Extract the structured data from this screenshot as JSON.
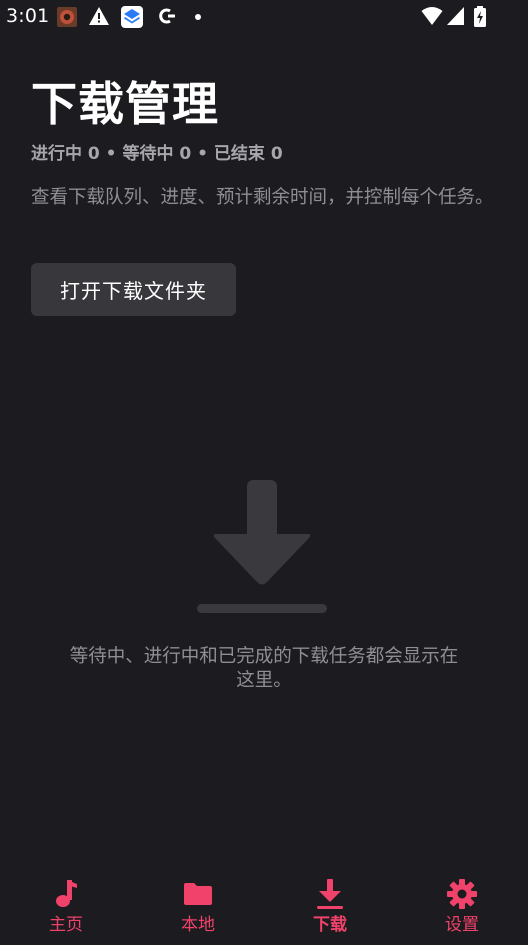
{
  "status_bar": {
    "time": "3:01",
    "left_icons": [
      "app-notification-icon",
      "warning-icon",
      "stack-app-icon",
      "c-app-icon",
      "dot-icon"
    ],
    "right_icons": [
      "wifi-icon",
      "signal-icon",
      "battery-charging-icon"
    ]
  },
  "header": {
    "title": "下载管理",
    "stats": "进行中 0 • 等待中 0 • 已结束 0",
    "description": "查看下载队列、进度、预计剩余时间，并控制每个任务。",
    "open_folder_label": "打开下载文件夹"
  },
  "empty_state": {
    "icon": "download-icon",
    "message": "等待中、进行中和已完成的下载任务都会显示在这里。"
  },
  "bottom_nav": {
    "items": [
      {
        "label": "主页",
        "icon": "music-note-icon"
      },
      {
        "label": "本地",
        "icon": "folder-icon"
      },
      {
        "label": "下载",
        "icon": "download-icon",
        "active": true
      },
      {
        "label": "设置",
        "icon": "settings-gear-icon"
      }
    ]
  },
  "colors": {
    "background": "#1c1b1f",
    "accent": "#f0426a",
    "button_bg": "#38373c",
    "muted_text": "#8f8e94",
    "empty_icon": "#3a393e"
  }
}
